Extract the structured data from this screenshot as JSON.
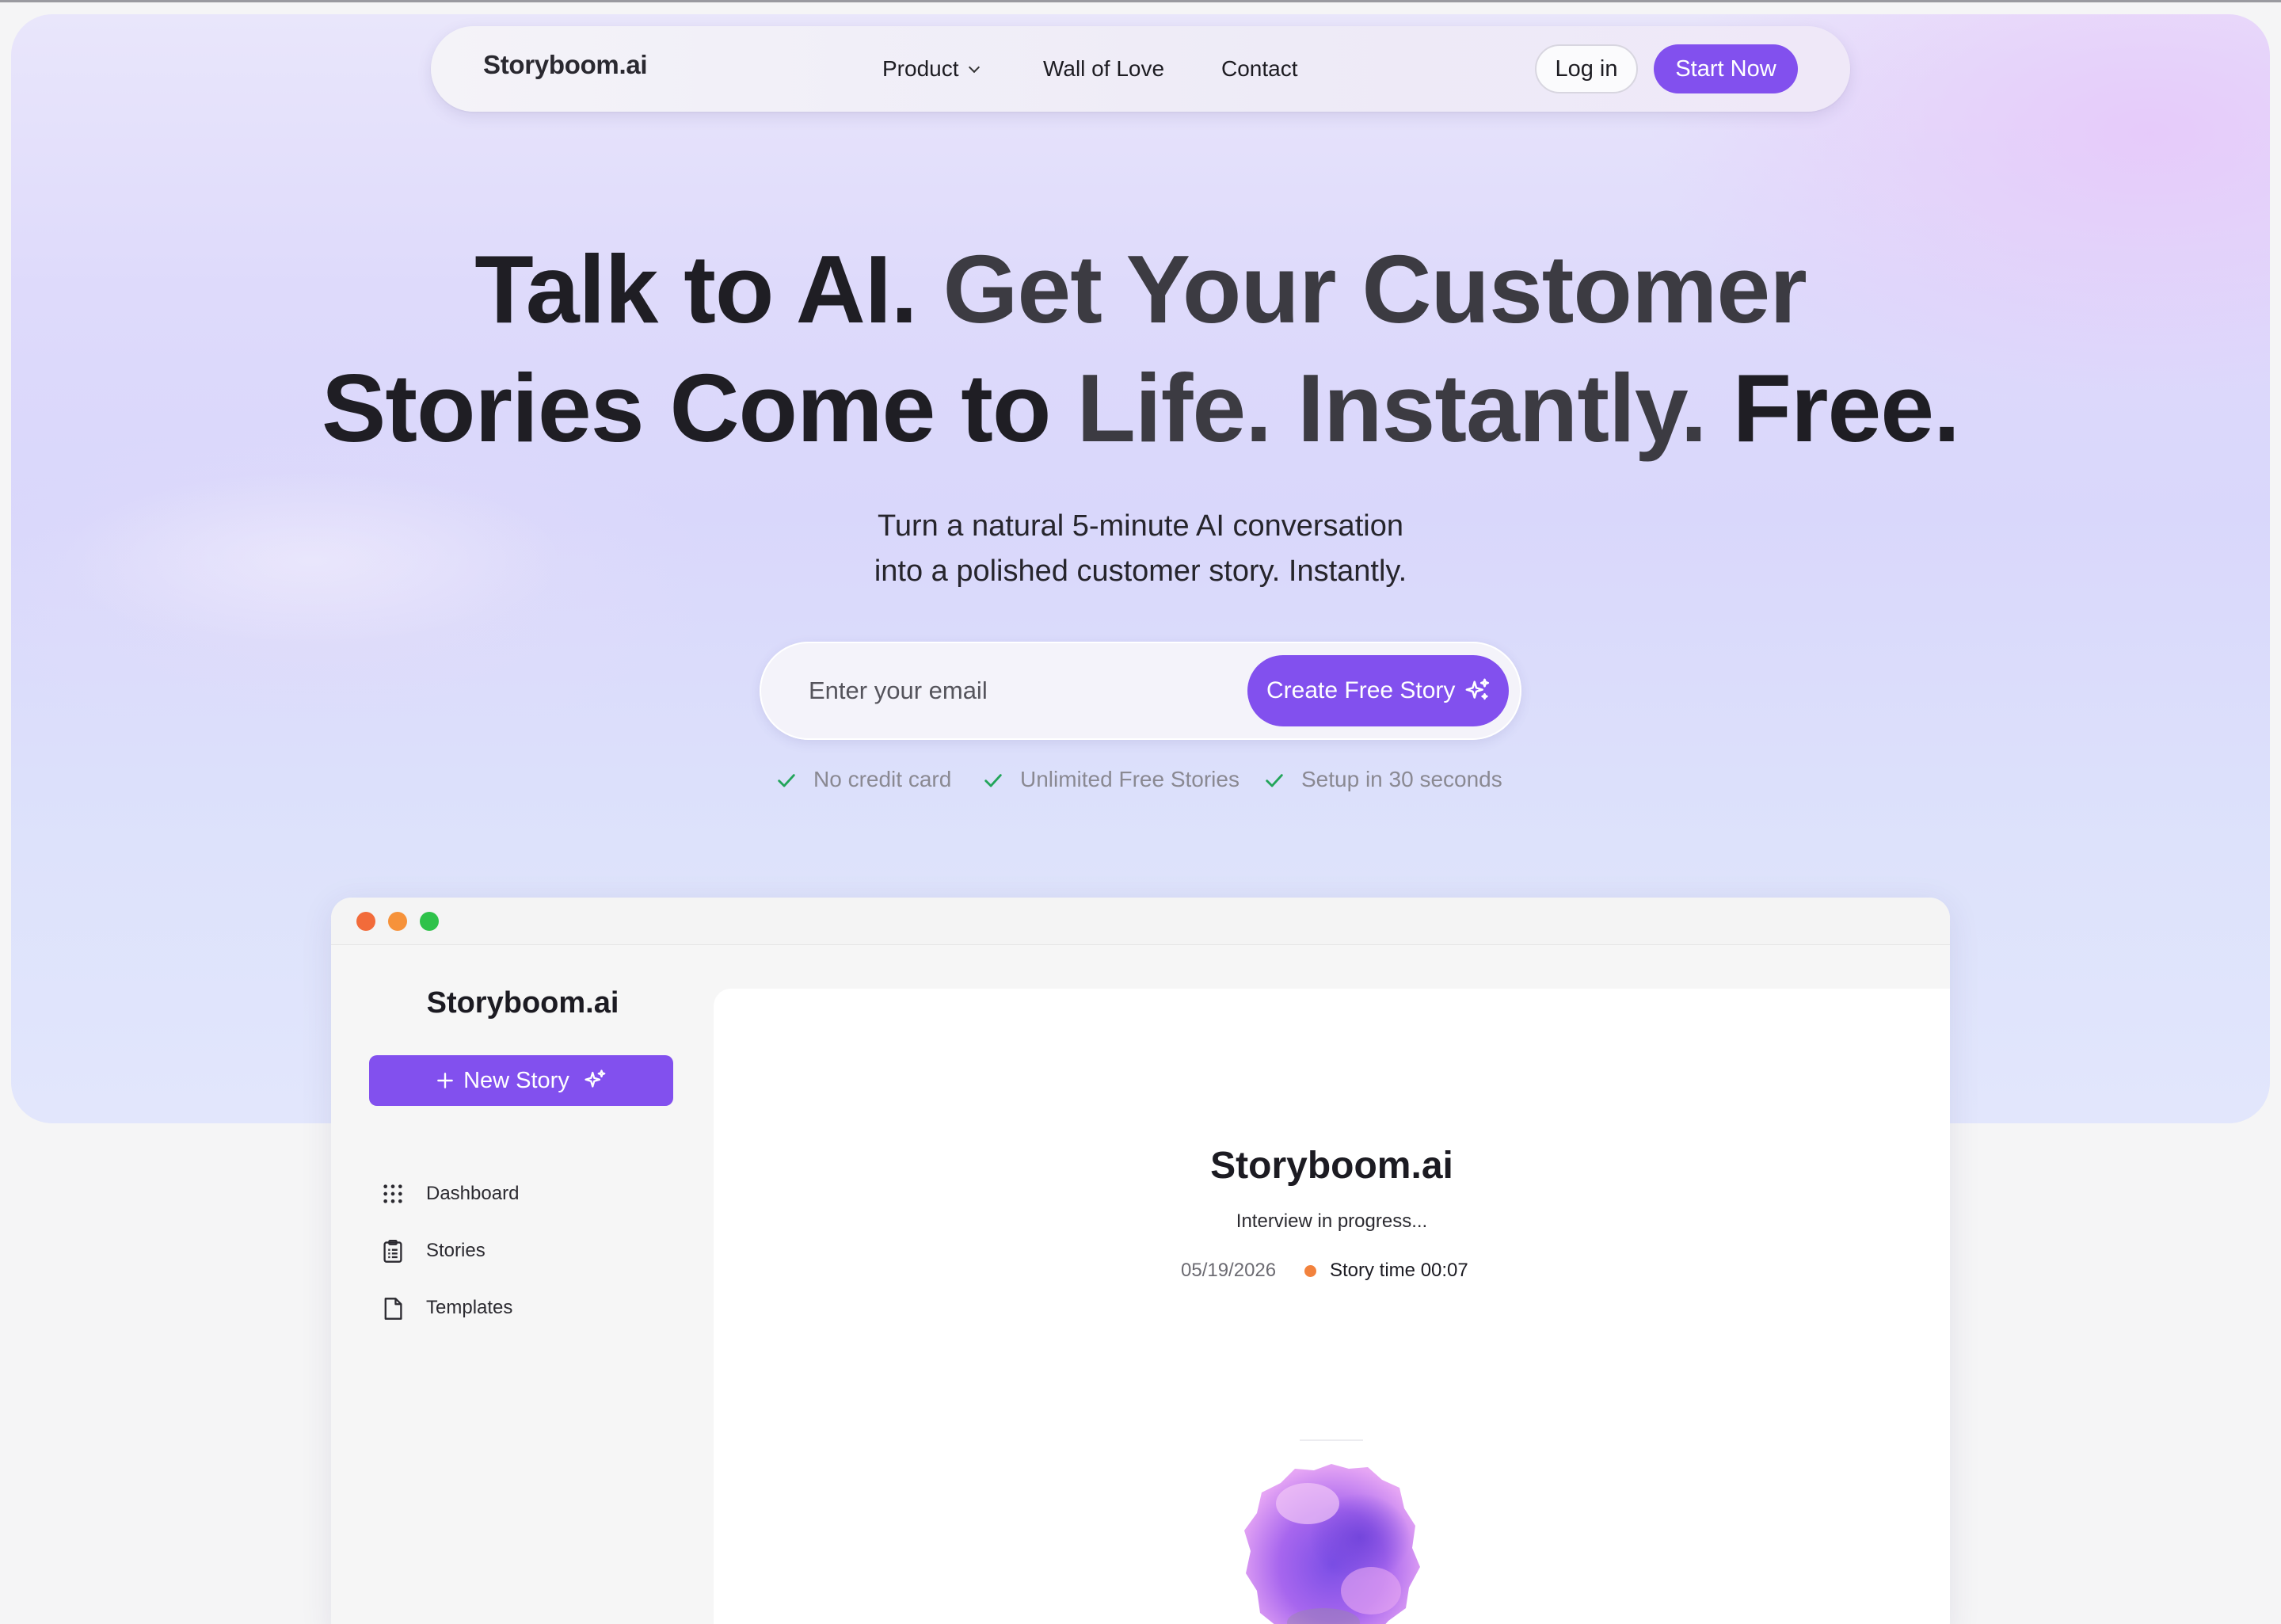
{
  "nav": {
    "brand": "Storyboom.ai",
    "links": [
      "Product",
      "Wall of Love",
      "Contact"
    ],
    "login_label": "Log in",
    "start_label": "Start Now"
  },
  "hero": {
    "headline_parts": [
      "Talk to AI.",
      "Get Your Customer",
      "Stories Come to",
      "Life. Instantly.",
      "Free."
    ],
    "subline_1": "Turn a natural 5-minute AI conversation",
    "subline_2": "into a polished customer story. Instantly.",
    "email_placeholder": "Enter your email",
    "cta_label": "Create Free Story",
    "checks": [
      "No credit card",
      "Unlimited Free Stories",
      "Setup in 30 seconds"
    ]
  },
  "app": {
    "sidebar": {
      "brand": "Storyboom.ai",
      "new_story_label": "New Story",
      "items": [
        "Dashboard",
        "Stories",
        "Templates"
      ]
    },
    "main": {
      "title": "Storyboom.ai",
      "status": "Interview in progress...",
      "date": "05/19/2026",
      "story_time": "Story time 00:07"
    }
  },
  "colors": {
    "accent": "#8250ee",
    "check_green": "#22a55a",
    "traffic_red": "#f26b3a",
    "traffic_orange": "#f6923a",
    "traffic_green": "#2ec24a",
    "recording_dot": "#f2823d"
  }
}
